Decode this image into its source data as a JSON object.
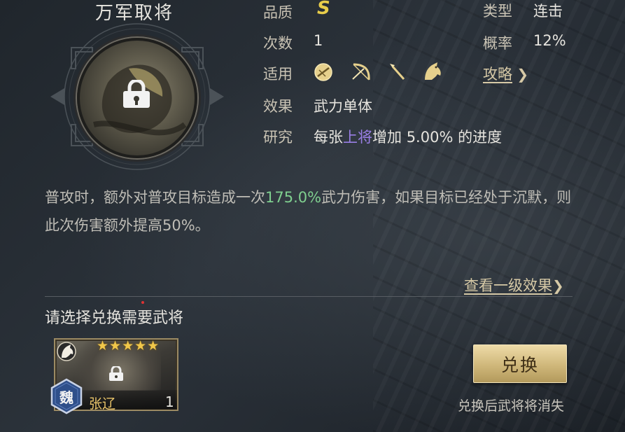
{
  "skill": {
    "name": "万军取将"
  },
  "info": {
    "quality_label": "品质",
    "quality_value": "S",
    "type_label": "类型",
    "type_value": "连击",
    "count_label": "次数",
    "count_value": "1",
    "chance_label": "概率",
    "chance_value": "12%",
    "applies_label": "适用",
    "applies_icons": [
      "shield-icon",
      "bow-icon",
      "spear-icon",
      "horse-icon"
    ],
    "guide_link": "攻略",
    "effect_label": "效果",
    "effect_value": "武力单体",
    "research_label": "研究",
    "research_prefix": "每张",
    "research_highlight": "上将",
    "research_middle": "增加",
    "research_amount": "5.00%",
    "research_suffix": "的进度"
  },
  "description": {
    "part1": "普攻时，额外对普攻目标造成一次",
    "highlight": "175.0%",
    "part2": "武力伤害，如果目标已经处于沉默，则此次伤害额外提高50%。"
  },
  "level_one_link": "查看一级效果",
  "exchange": {
    "section_title": "请选择兑换需要武将",
    "general": {
      "name": "张辽",
      "faction": "魏",
      "count": "1",
      "stars": 5,
      "stars_text": "★★★★★"
    },
    "button_label": "兑换",
    "note": "兑换后武将将消失"
  },
  "colors": {
    "grade": "#e8cd4a",
    "purple_highlight": "#9a7fe6",
    "green_highlight": "#7fcf8f",
    "link": "#d6c9a6",
    "button_gold": "#cfb77a"
  }
}
